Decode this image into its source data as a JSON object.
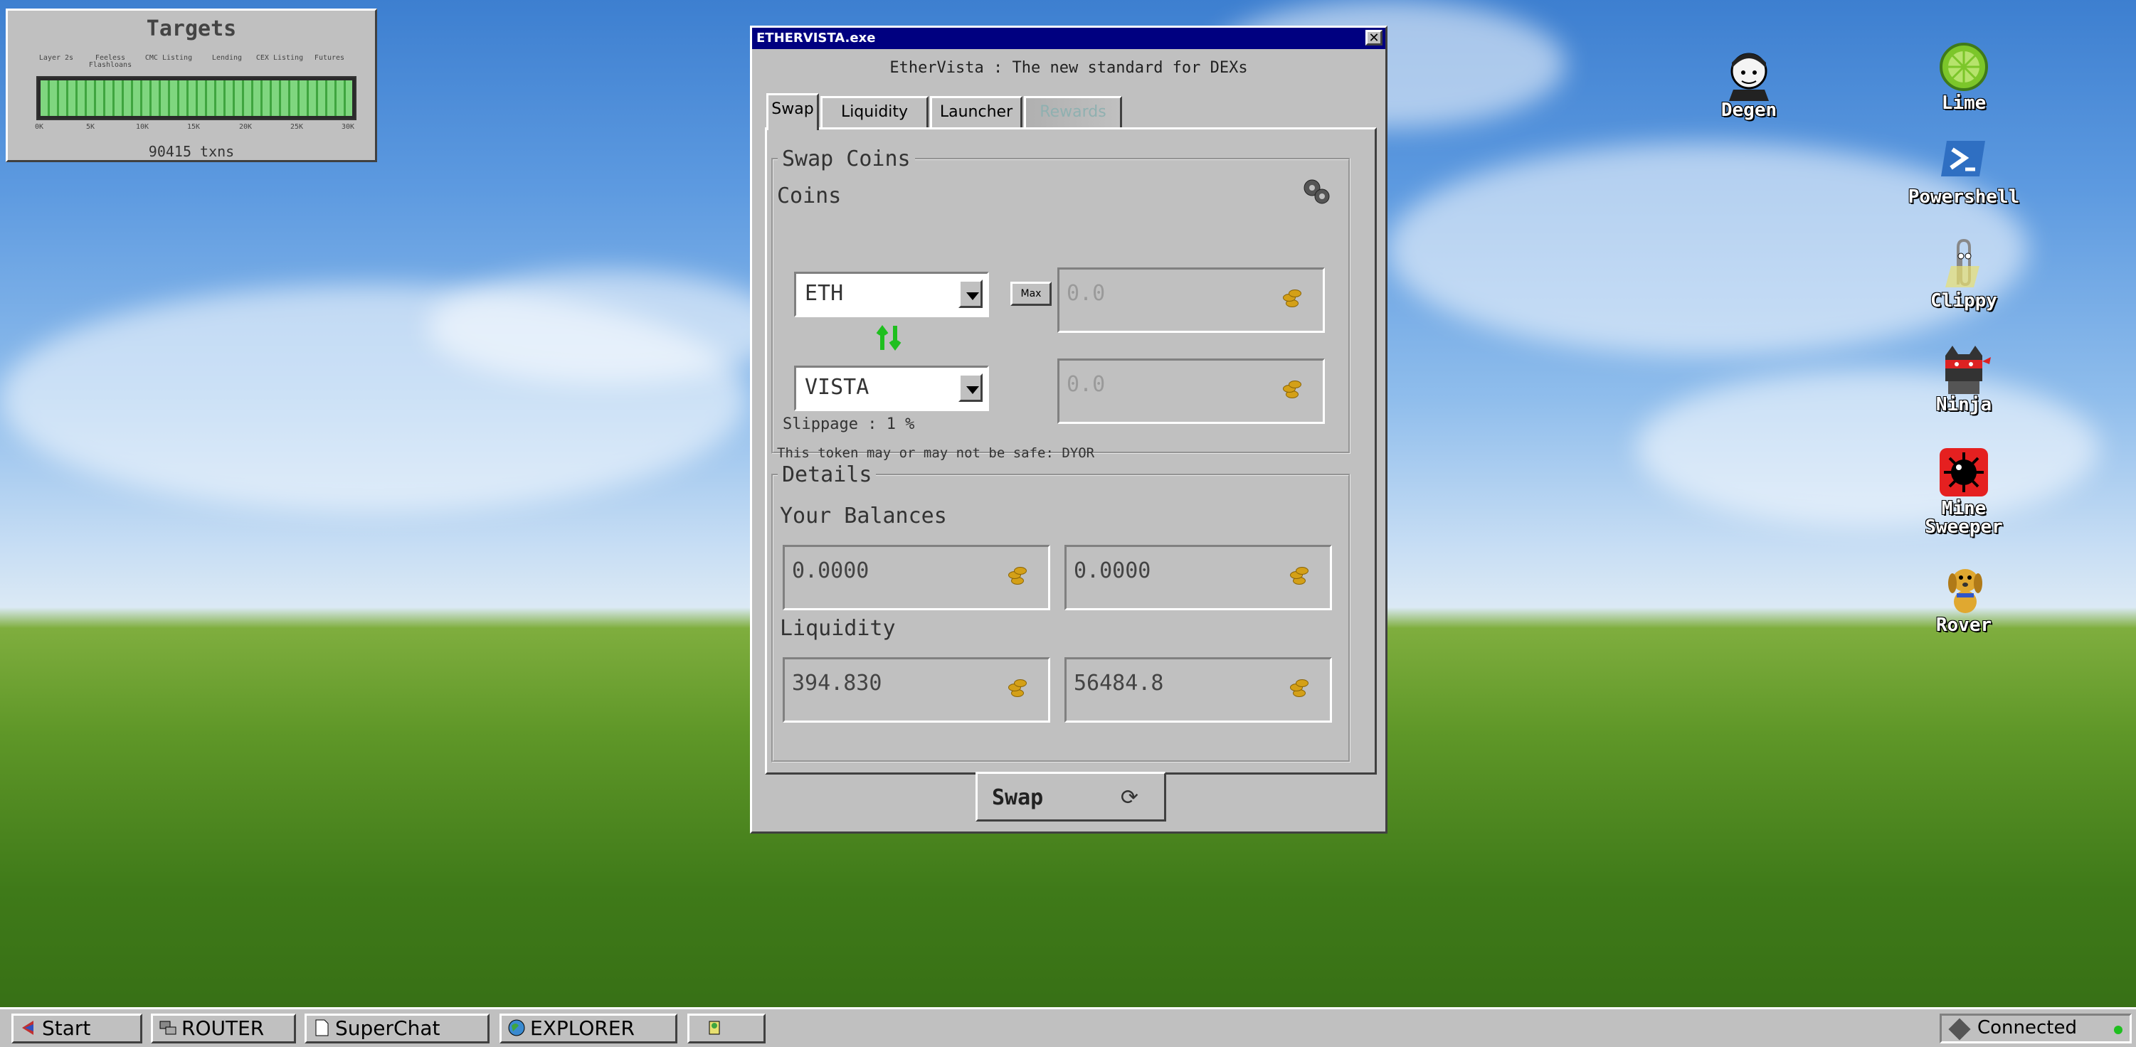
{
  "colors": {
    "titlebar": "#000080",
    "window": "#c0c0c0",
    "progress_fill": "#7fd67f",
    "connected": "#1fbf1f",
    "rewards_tab": "#8fb0b0"
  },
  "targets": {
    "title": "Targets",
    "milestones": [
      "Layer 2s",
      "Feeless Flashloans",
      "CMC Listing",
      "Lending",
      "CEX Listing",
      "Futures"
    ],
    "ticks": [
      "0K",
      "5K",
      "10K",
      "15K",
      "20K",
      "25K",
      "30K"
    ],
    "progress_fraction": 1.0,
    "txns_label": "90415 txns"
  },
  "window": {
    "title": "ETHERVISTA.exe",
    "close_glyph": "✕",
    "subtitle": "EtherVista : The new standard for DEXs",
    "tabs": [
      "Swap",
      "Liquidity",
      "Launcher",
      "Rewards"
    ],
    "active_tab": "Swap"
  },
  "swap": {
    "legend": "Swap Coins",
    "coins_label": "Coins",
    "settings_icon": "gear-icon",
    "from_coin": "ETH",
    "max_label": "Max",
    "from_amount": "0.0",
    "swap_direction_icon": "swap-arrows-icon",
    "to_coin": "VISTA",
    "to_amount": "0.0",
    "slippage": "Slippage : 1 %",
    "warning": "This token may or may not be safe: DYOR"
  },
  "details": {
    "legend": "Details",
    "balances_label": "Your Balances",
    "balance_a": "0.0000",
    "balance_b": "0.0000",
    "liquidity_label": "Liquidity",
    "liquidity_a": "394.830",
    "liquidity_b": "56484.8"
  },
  "swap_button": {
    "label": "Swap",
    "icon_glyph": "⟳"
  },
  "desktop_icons": [
    "Degen",
    "Lime",
    "Powershell",
    "Clippy",
    "Ninja",
    "Mine Sweeper",
    "Rover"
  ],
  "taskbar": {
    "start": "Start",
    "buttons": [
      "ROUTER",
      "SuperChat",
      "EXPLORER"
    ],
    "status": "Connected"
  }
}
